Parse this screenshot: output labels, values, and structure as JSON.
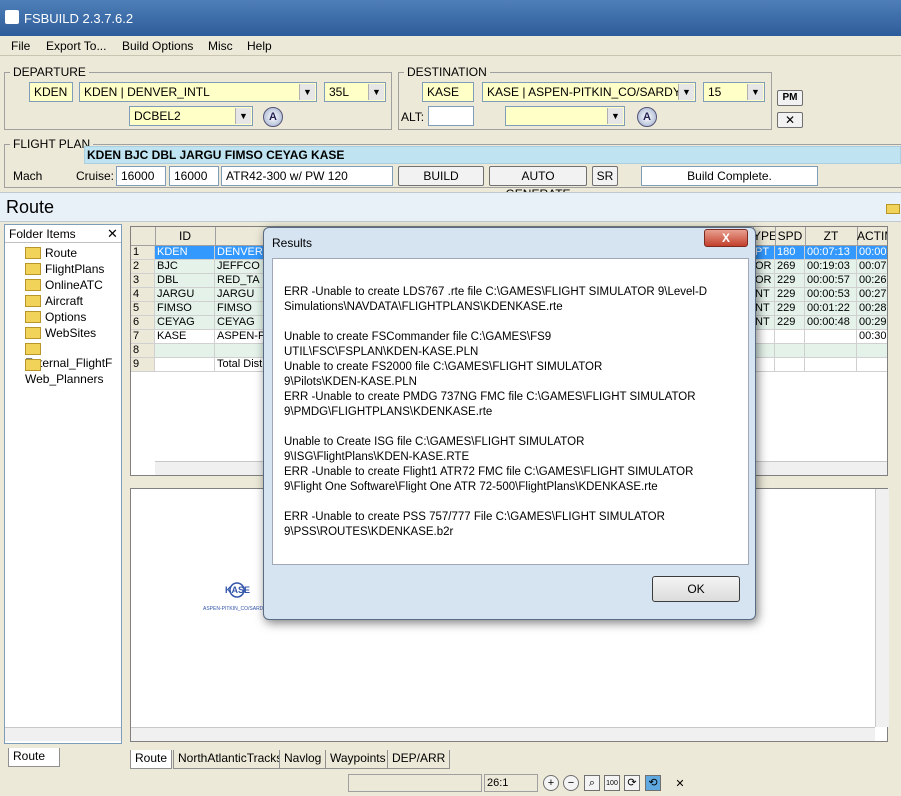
{
  "window": {
    "title": "FSBUILD 2.3.7.6.2"
  },
  "menu": {
    "items": [
      "File",
      "Export To...",
      "Build Options",
      "Misc",
      "Help"
    ]
  },
  "departure": {
    "label": "DEPARTURE",
    "icao": "KDEN",
    "airport": "KDEN | DENVER_INTL",
    "runway": "35L",
    "procedure": "DCBEL2"
  },
  "destination": {
    "label": "DESTINATION",
    "icao": "KASE",
    "airport": "KASE | ASPEN-PITKIN_CO/SARDY",
    "runway": "15",
    "alt_label": "ALT:",
    "alt_value": "",
    "procedure": ""
  },
  "pm_button": "PM",
  "flight_plan": {
    "label": "FLIGHT PLAN",
    "route": "KDEN BJC DBL JARGU FIMSO CEYAG KASE",
    "mach_label": "Mach",
    "cruise_label": "Cruise:",
    "cruise1": "16000",
    "cruise2": "16000",
    "aircraft": "ATR42-300 w/ PW 120",
    "build_label": "BUILD",
    "auto_label": "AUTO GENERATE",
    "sr_label": "SR",
    "status": "Build Complete."
  },
  "route_title": "Route",
  "folders": {
    "header": "Folder Items",
    "items": [
      "Route",
      "FlightPlans",
      "OnlineATC",
      "Aircraft",
      "Options",
      "WebSites",
      "External_FlightF",
      "Web_Planners"
    ]
  },
  "grid": {
    "headers": [
      "ID",
      "YPE",
      "SPD",
      "ZT",
      "ACTIM"
    ],
    "rows": [
      {
        "n": "1",
        "id": "KDEN",
        "name": "DENVER",
        "type": "PT",
        "spd": "180",
        "zt": "00:07:13",
        "act": "00:00:"
      },
      {
        "n": "2",
        "id": "BJC",
        "name": "JEFFCO",
        "type": "OR",
        "spd": "269",
        "zt": "00:19:03",
        "act": "00:07:"
      },
      {
        "n": "3",
        "id": "DBL",
        "name": "RED_TA",
        "type": "OR",
        "spd": "229",
        "zt": "00:00:57",
        "act": "00:26:"
      },
      {
        "n": "4",
        "id": "JARGU",
        "name": "JARGU",
        "type": "NT",
        "spd": "229",
        "zt": "00:00:53",
        "act": "00:27:"
      },
      {
        "n": "5",
        "id": "FIMSO",
        "name": "FIMSO",
        "type": "NT",
        "spd": "229",
        "zt": "00:01:22",
        "act": "00:28:"
      },
      {
        "n": "6",
        "id": "CEYAG",
        "name": "CEYAG",
        "type": "NT",
        "spd": "229",
        "zt": "00:00:48",
        "act": "00:29:"
      },
      {
        "n": "7",
        "id": "KASE",
        "name": "ASPEN-P",
        "type": "",
        "spd": "",
        "zt": "",
        "act": "00:30:"
      },
      {
        "n": "8",
        "id": "",
        "name": "",
        "type": "",
        "spd": "",
        "zt": "",
        "act": ""
      },
      {
        "n": "9",
        "id": "",
        "name": "Total Dist",
        "type": "",
        "spd": "",
        "zt": "",
        "act": ""
      }
    ]
  },
  "map": {
    "marker_label": "KASE",
    "marker_sub": "ASPEN-PITKIN_CO/SARDY"
  },
  "dialog": {
    "title": "Results",
    "close": "X",
    "lines": [
      "ERR  -Unable to create LDS767 .rte  file C:\\GAMES\\FLIGHT SIMULATOR 9\\Level-D",
      "Simulations\\NAVDATA\\FLIGHTPLANS\\KDENKASE.rte",
      "Unable to create FSCommander file  C:\\GAMES\\FS9",
      "UTIL\\FSC\\FSPLAN\\KDEN-KASE.PLN",
      "Unable to create FS2000 file  C:\\GAMES\\FLIGHT SIMULATOR",
      "9\\Pilots\\KDEN-KASE.PLN",
      "ERR  -Unable to create PMDG 737NG FMC file C:\\GAMES\\FLIGHT SIMULATOR",
      "9\\PMDG\\FLIGHTPLANS\\KDENKASE.rte",
      "Unable to Create ISG file  C:\\GAMES\\FLIGHT SIMULATOR",
      "9\\ISG\\FlightPlans\\KDEN-KASE.RTE",
      "ERR  -Unable to create Flight1 ATR72 FMC file C:\\GAMES\\FLIGHT SIMULATOR",
      "9\\Flight One Software\\Flight One ATR 72-500\\FlightPlans\\KDENKASE.rte",
      "ERR -Unable to create PSS 757/777 File C:\\GAMES\\FLIGHT SIMULATOR",
      "9\\PSS\\ROUTES\\KDENKASE.b2r"
    ],
    "ok_label": "OK"
  },
  "left_tab": "Route",
  "bottom_tabs": [
    "Route",
    "NorthAtlanticTracks",
    "Navlog",
    "Waypoints",
    "DEP/ARR"
  ],
  "statusbar": {
    "zoom": "26:1"
  }
}
